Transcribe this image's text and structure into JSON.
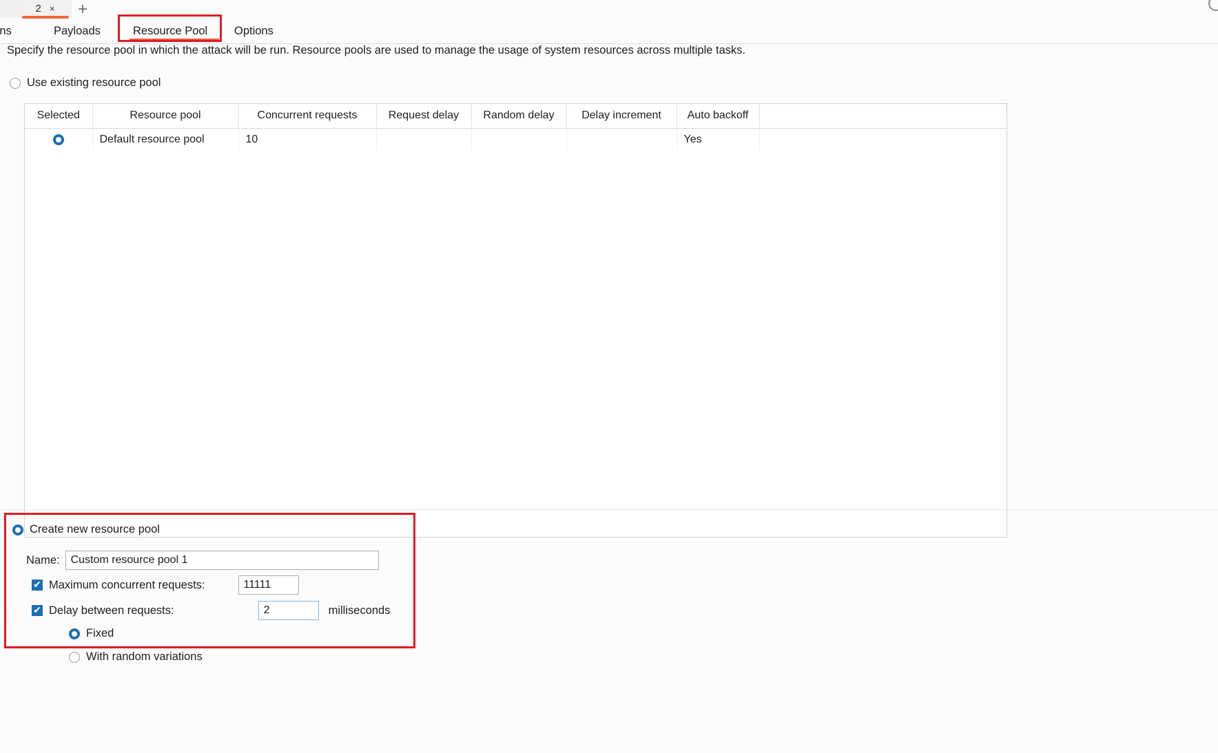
{
  "browser": {
    "tab_label": "2",
    "tab_close_icon": "close-icon",
    "tab_close_glyph": "×",
    "new_tab_glyph": "+",
    "accent_orange": "#f0663a"
  },
  "subnav": {
    "items": [
      {
        "id": "intruder",
        "label": "tions",
        "active": false
      },
      {
        "id": "payloads",
        "label": "Payloads",
        "active": false
      },
      {
        "id": "resource-pool",
        "label": "Resource Pool",
        "active": true
      },
      {
        "id": "options",
        "label": "Options",
        "active": false
      }
    ]
  },
  "annotations": {
    "color": "#e01b24",
    "tab_highlight": "Resource Pool",
    "section_highlight": "Create new resource pool"
  },
  "panel": {
    "description": "Specify the resource pool in which the attack will be run. Resource pools are used to manage the usage of system resources across multiple tasks.",
    "use_existing_label": "Use existing resource pool",
    "use_existing_selected": false
  },
  "table": {
    "columns": [
      "Selected",
      "Resource pool",
      "Concurrent requests",
      "Request delay",
      "Random delay",
      "Delay increment",
      "Auto backoff"
    ],
    "rows": [
      {
        "selected": true,
        "resource_pool": "Default resource pool",
        "concurrent_requests": "10",
        "request_delay": "",
        "random_delay": "",
        "delay_increment": "",
        "auto_backoff": "Yes"
      }
    ]
  },
  "create_new": {
    "radio_label": "Create new resource pool",
    "radio_selected": true,
    "name_label": "Name:",
    "name_value": "Custom resource pool 1",
    "max_concurrent_label": "Maximum concurrent requests:",
    "max_concurrent_checked": true,
    "max_concurrent_value": "11111",
    "delay_label": "Delay between requests:",
    "delay_checked": true,
    "delay_value": "2",
    "delay_unit": "milliseconds",
    "fixed_label": "Fixed",
    "fixed_selected": true,
    "random_label": "With random variations",
    "random_selected": false,
    "checkbox_tick": "✔",
    "selection_accent": "#1a6fb5"
  }
}
